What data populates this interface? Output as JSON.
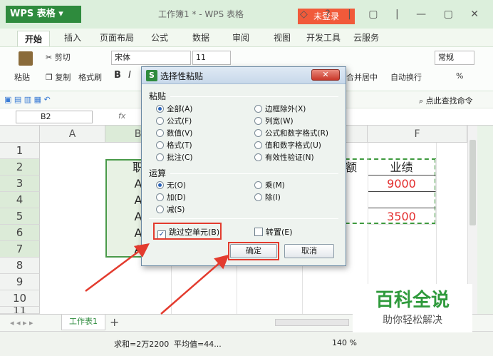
{
  "titlebar": {
    "app": "WPS 表格",
    "doc": "工作簿1 * - WPS 表格",
    "login": "未登录",
    "controls": "◇ ? | ▢ | — ▢ ✕"
  },
  "tabs": [
    "开始",
    "插入",
    "页面布局",
    "公式",
    "数据",
    "审阅",
    "视图",
    "开发工具",
    "云服务"
  ],
  "ribbon": {
    "paste": "粘贴",
    "cut": "剪切",
    "copy": "复制",
    "format_painter": "格式刷",
    "font": "宋体",
    "size": "11",
    "bold": "B",
    "italic": "I",
    "merge": "合并居中",
    "wrap": "自动换行",
    "numfmt": "常规",
    "percent": "%"
  },
  "quick": {
    "find": "点此查找命令"
  },
  "formula": {
    "cellref": "B2",
    "fx": "fx"
  },
  "columns": [
    "A",
    "B",
    "C",
    "D",
    "E",
    "F"
  ],
  "rows": [
    "1",
    "2",
    "3",
    "4",
    "5",
    "6",
    "7",
    "8",
    "9",
    "10",
    "11"
  ],
  "cells": {
    "b2": "职",
    "b3": "A",
    "b4": "A",
    "b5": "A",
    "b6": "A",
    "b7": "A",
    "e2": "额",
    "f2": "业绩",
    "f3": "9000",
    "f5": "3500"
  },
  "dialog": {
    "title": "选择性粘贴",
    "close": "✕",
    "paste_section": "粘贴",
    "paste_options": [
      "全部(A)",
      "公式(F)",
      "数值(V)",
      "格式(T)",
      "批注(C)"
    ],
    "paste_options_right": [
      "边框除外(X)",
      "列宽(W)",
      "公式和数字格式(R)",
      "值和数字格式(U)",
      "有效性验证(N)"
    ],
    "op_section": "运算",
    "op_options": [
      "无(O)",
      "加(D)",
      "减(S)"
    ],
    "op_options_right": [
      "乘(M)",
      "除(I)"
    ],
    "skip_blanks": "跳过空单元(B)",
    "transpose": "转置(E)",
    "ok": "确定",
    "cancel": "取消"
  },
  "sheet": {
    "tab": "工作表1",
    "add": "+"
  },
  "status": {
    "sum": "求和=2万2200",
    "avg": "平均值=44...",
    "zoom": "140 %"
  },
  "watermark": {
    "title": "百科全说",
    "subtitle": "助你轻松解决"
  },
  "colors": {
    "accent": "#2e8b3d",
    "login": "#f15a3a",
    "red_highlight": "#e33b2e",
    "value_red": "#e32d2d"
  }
}
